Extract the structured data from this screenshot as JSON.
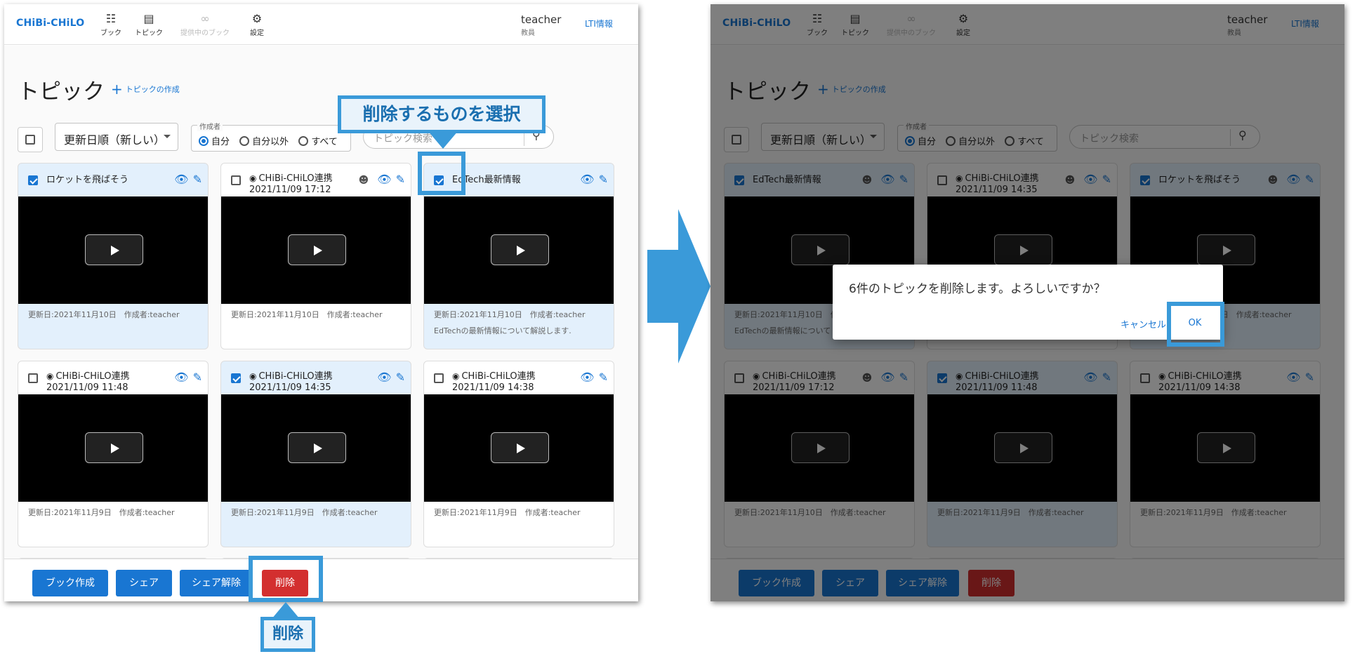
{
  "app": {
    "logo": "CHiBi-CHiLO",
    "nav": [
      {
        "label": "ブック",
        "icon": "book-icon"
      },
      {
        "label": "トピック",
        "icon": "topic-icon"
      },
      {
        "label": "提供中のブック",
        "icon": "link-icon",
        "disabled": true
      },
      {
        "label": "設定",
        "icon": "gear-icon"
      }
    ],
    "user_name": "teacher",
    "user_role": "教員",
    "lti_link": "LTI情報"
  },
  "page": {
    "title": "トピック",
    "add_topic": "トピックの作成",
    "sort_value": "更新日順（新しい）",
    "creator_legend": "作成者",
    "creator_options": [
      "自分",
      "自分以外",
      "すべて"
    ],
    "creator_selected": "自分",
    "search_placeholder": "トピック検索"
  },
  "panel1": {
    "cards": [
      {
        "title": "ロケットを飛ばそう",
        "checked": true,
        "shared": false,
        "meta": "更新日:2021年11月10日　作成者:teacher",
        "desc": ""
      },
      {
        "title": "CHiBi-CHiLO連携",
        "subtitle": "2021/11/09 17:12",
        "checked": false,
        "shared": true,
        "meta": "更新日:2021年11月10日　作成者:teacher",
        "desc": ""
      },
      {
        "title": "EdTech最新情報",
        "checked": true,
        "shared": false,
        "meta": "更新日:2021年11月10日　作成者:teacher",
        "desc": "EdTechの最新情報について解説します."
      },
      {
        "title": "CHiBi-CHiLO連携",
        "subtitle": "2021/11/09 11:48",
        "checked": false,
        "shared": false,
        "meta": "更新日:2021年11月9日　作成者:teacher",
        "desc": ""
      },
      {
        "title": "CHiBi-CHiLO連携",
        "subtitle": "2021/11/09 14:35",
        "checked": true,
        "shared": false,
        "meta": "更新日:2021年11月9日　作成者:teacher",
        "desc": ""
      },
      {
        "title": "CHiBi-CHiLO連携",
        "subtitle": "2021/11/09 14:38",
        "checked": false,
        "shared": false,
        "meta": "更新日:2021年11月9日　作成者:teacher",
        "desc": ""
      }
    ]
  },
  "panel2": {
    "cards": [
      {
        "title": "EdTech最新情報",
        "checked": true,
        "shared": true,
        "meta": "更新日:2021年11月10日　作成者:teacher",
        "desc": "EdTechの最新情報について"
      },
      {
        "title": "CHiBi-CHiLO連携",
        "subtitle": "2021/11/09 14:35",
        "checked": false,
        "shared": true,
        "meta": "",
        "desc": ""
      },
      {
        "title": "ロケットを飛ばそう",
        "checked": true,
        "shared": true,
        "meta": "更新日:2021年11月10日　作成者:teacher",
        "desc": ""
      },
      {
        "title": "CHiBi-CHiLO連携",
        "subtitle": "2021/11/09 17:12",
        "checked": false,
        "shared": true,
        "meta": "更新日:2021年11月10日　作成者:teacher",
        "desc": ""
      },
      {
        "title": "CHiBi-CHiLO連携",
        "subtitle": "2021/11/09 11:48",
        "checked": true,
        "shared": false,
        "meta": "更新日:2021年11月9日　作成者:teacher",
        "desc": ""
      },
      {
        "title": "CHiBi-CHiLO連携",
        "subtitle": "2021/11/09 14:38",
        "checked": false,
        "shared": false,
        "meta": "更新日:2021年11月9日　作成者:teacher",
        "desc": ""
      }
    ],
    "dialog": {
      "message": "6件のトピックを削除します。よろしいですか？",
      "cancel": "キャンセル",
      "ok": "OK"
    }
  },
  "actions": {
    "create_book": "ブック作成",
    "share": "シェア",
    "unshare": "シェア解除",
    "delete": "削除"
  },
  "callouts": {
    "select_to_delete": "削除するものを選択",
    "delete": "削除"
  },
  "colors": {
    "accent": "#1976d2",
    "danger": "#d32f2f",
    "callout_border": "#3a9ad9",
    "selected_card": "#e3f0fc"
  }
}
